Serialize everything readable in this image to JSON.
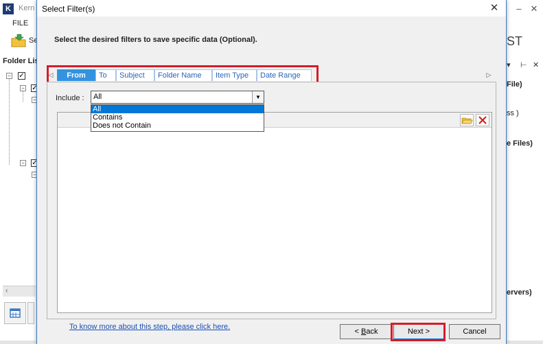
{
  "background_app": {
    "logo_letter": "K",
    "title_fragment": "Kern",
    "file_menu": "FILE",
    "toolbar_label_fragment": "Se",
    "folder_list_label": "Folder Lis",
    "right_fragment": "ST",
    "right_texts": [
      "File)",
      "ss )",
      "e Files)",
      "ervers)"
    ],
    "pin_icon": "⊢",
    "dropdown_icon": "▾",
    "close_icon": "✕"
  },
  "dialog": {
    "title": "Select Filter(s)",
    "close_glyph": "✕",
    "instruction": "Select the desired filters to save specific data (Optional).",
    "tabs": [
      {
        "label": "From",
        "active": true
      },
      {
        "label": "To",
        "active": false
      },
      {
        "label": "Subject",
        "active": false
      },
      {
        "label": "Folder Name",
        "active": false
      },
      {
        "label": "Item Type",
        "active": false
      },
      {
        "label": "Date Range",
        "active": false
      }
    ],
    "tab_scroll_left": "◁",
    "tab_scroll_right": "▷",
    "include": {
      "label": "Include :",
      "selected": "All",
      "options": [
        "All",
        "Contains",
        "Does not Contain"
      ]
    },
    "help_link": "To know more about this step, please click here.",
    "buttons": {
      "back_prefix": "< ",
      "back_underlined": "B",
      "back_rest": "ack",
      "next": "Next >",
      "cancel": "Cancel"
    },
    "highlight_color": "#d51c2a",
    "accent_color": "#3393df"
  }
}
